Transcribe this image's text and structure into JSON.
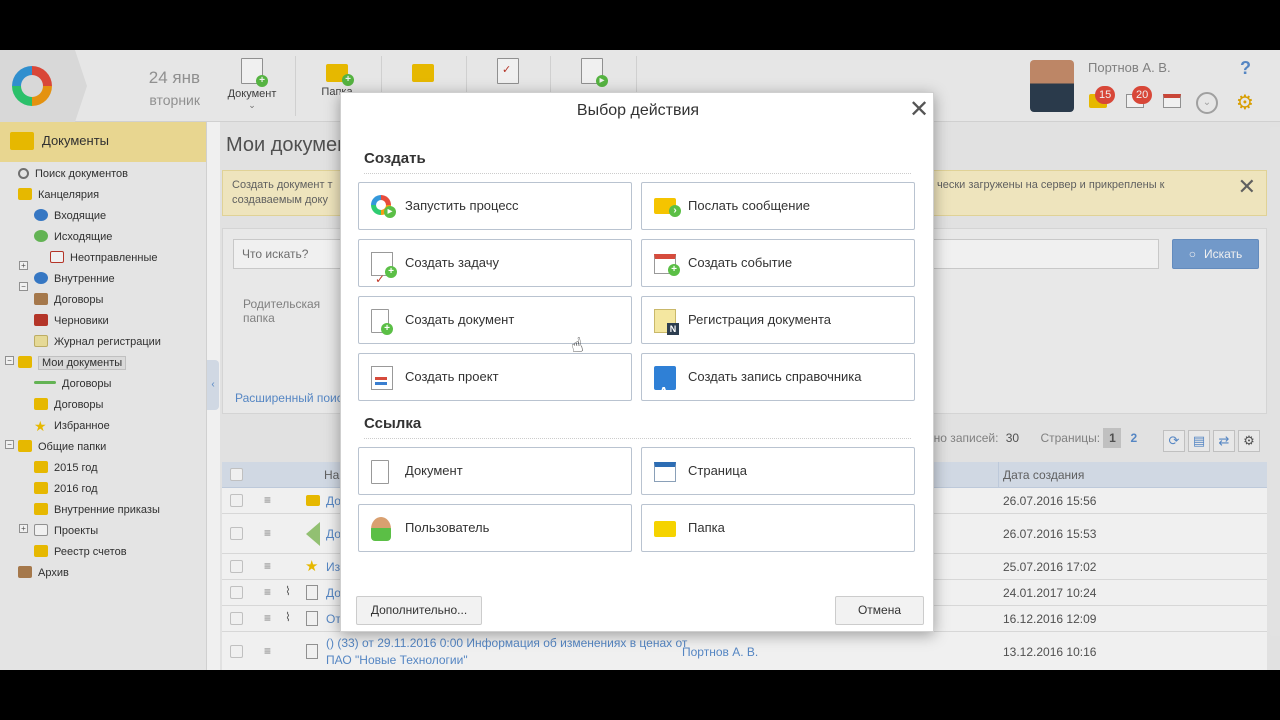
{
  "header": {
    "date_day": "24 янв",
    "date_weekday": "вторник",
    "toolbar": [
      {
        "label": "Документ",
        "icon": "document-plus-icon"
      },
      {
        "label": "Папка",
        "icon": "folder-plus-icon"
      },
      {
        "label": "",
        "icon": "folders-icon"
      },
      {
        "label": "",
        "icon": "tasks-icon"
      },
      {
        "label": "",
        "icon": "process-icon"
      }
    ],
    "user_name": "Портнов А. В.",
    "badge_messages": "15",
    "badge_tasks": "20",
    "help": "?"
  },
  "sidebar": {
    "title": "Документы",
    "items": [
      {
        "label": "Поиск документов"
      },
      {
        "label": "Канцелярия"
      },
      {
        "label": "Входящие"
      },
      {
        "label": "Исходящие"
      },
      {
        "label": "Неотправленные"
      },
      {
        "label": "Внутренние"
      },
      {
        "label": "Договоры"
      },
      {
        "label": "Черновики"
      },
      {
        "label": "Журнал регистрации"
      },
      {
        "label": "Мои документы"
      },
      {
        "label": "Договоры"
      },
      {
        "label": "Договоры"
      },
      {
        "label": "Избранное"
      },
      {
        "label": "Общие папки"
      },
      {
        "label": "2015 год"
      },
      {
        "label": "2016 год"
      },
      {
        "label": "Внутренние приказы"
      },
      {
        "label": "Проекты"
      },
      {
        "label": "Реестр счетов"
      },
      {
        "label": "Архив"
      }
    ]
  },
  "main": {
    "title": "Мои докумен",
    "notice_left": "Создать документ т",
    "notice_left2": "создаваемым доку",
    "notice_right": "чески загружены на сервер и прикреплены к",
    "search_placeholder": "Что искать?",
    "search_button": "Искать",
    "parent_label": "Родительская папка",
    "advanced_link": "Расширенный поис",
    "records_label": "дено записей:",
    "records_count": "30",
    "pages_label": "Страницы:",
    "page_current": "1",
    "page_next": "2",
    "grid_header_name": "На",
    "grid_header_date": "Дата создания",
    "rows": [
      {
        "name": "До",
        "date": "26.07.2016 15:56"
      },
      {
        "name": "До",
        "date": "26.07.2016 15:53"
      },
      {
        "name": "Из",
        "date": "25.07.2016 17:02"
      },
      {
        "name": "До",
        "date": "24.01.2017 10:24"
      },
      {
        "name": "От",
        "date": "16.12.2016 12:09"
      }
    ],
    "last_row_line1": "() (33) от 29.11.2016 0:00 Информация об изменениях в ценах от",
    "last_row_line2": "ПАО \"Новые Технологии\"",
    "last_row_author": "Портнов А. В.",
    "last_row_date": "13.12.2016 10:16"
  },
  "modal": {
    "title": "Выбор действия",
    "section_create": "Создать",
    "create_actions": [
      {
        "label": "Запустить процесс",
        "icon": "process-ring-icon"
      },
      {
        "label": "Послать сообщение",
        "icon": "envelope-icon"
      },
      {
        "label": "Создать задачу",
        "icon": "task-icon"
      },
      {
        "label": "Создать событие",
        "icon": "calendar-icon"
      },
      {
        "label": "Создать документ",
        "icon": "document-plus-icon"
      },
      {
        "label": "Регистрация документа",
        "icon": "registration-icon"
      },
      {
        "label": "Создать проект",
        "icon": "project-icon"
      },
      {
        "label": "Создать запись справочника",
        "icon": "directory-book-icon"
      }
    ],
    "section_link": "Ссылка",
    "link_actions": [
      {
        "label": "Документ",
        "icon": "document-icon"
      },
      {
        "label": "Страница",
        "icon": "page-icon"
      },
      {
        "label": "Пользователь",
        "icon": "user-icon"
      },
      {
        "label": "Папка",
        "icon": "folder-icon"
      }
    ],
    "more_button": "Дополнительно...",
    "cancel_button": "Отмена"
  }
}
